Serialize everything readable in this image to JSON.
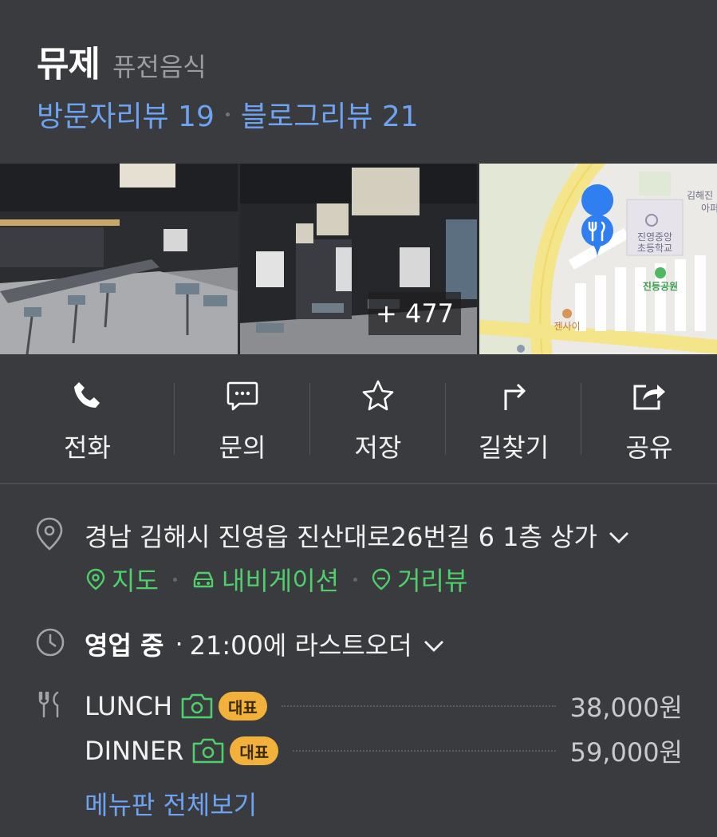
{
  "header": {
    "name": "뮤제",
    "category": "퓨전음식",
    "visitor_reviews": "방문자리뷰 19",
    "blog_reviews": "블로그리뷰 21"
  },
  "photos": {
    "more_count": "+ 477",
    "map_labels": {
      "school": "진영중앙\n초등학교",
      "school_line1": "진영중앙",
      "school_line2": "초등학교",
      "park": "진등공원",
      "restaurant": "젠사이",
      "top_right_1": "김해진",
      "top_right_2": "아퍼"
    }
  },
  "actions": [
    {
      "label": "전화",
      "icon": "phone-icon"
    },
    {
      "label": "문의",
      "icon": "chat-icon"
    },
    {
      "label": "저장",
      "icon": "star-icon"
    },
    {
      "label": "길찾기",
      "icon": "directions-icon"
    },
    {
      "label": "공유",
      "icon": "share-icon"
    }
  ],
  "info": {
    "address": "경남 김해시 진영읍 진산대로26번길 6 1층 상가",
    "links": {
      "map": "지도",
      "navigation": "내비게이션",
      "street_view": "거리뷰"
    },
    "status": "영업 중",
    "last_order": "21:00에 라스트오더",
    "menu": [
      {
        "name": "LUNCH",
        "badge": "대표",
        "price": "38,000원"
      },
      {
        "name": "DINNER",
        "badge": "대표",
        "price": "59,000원"
      }
    ],
    "full_menu_link": "메뉴판 전체보기"
  },
  "colors": {
    "background": "#3a3b3f",
    "link_blue": "#6ea3f0",
    "link_green": "#4fcf6a",
    "badge": "#f2b13a",
    "map_pin": "#2f7ff0"
  }
}
